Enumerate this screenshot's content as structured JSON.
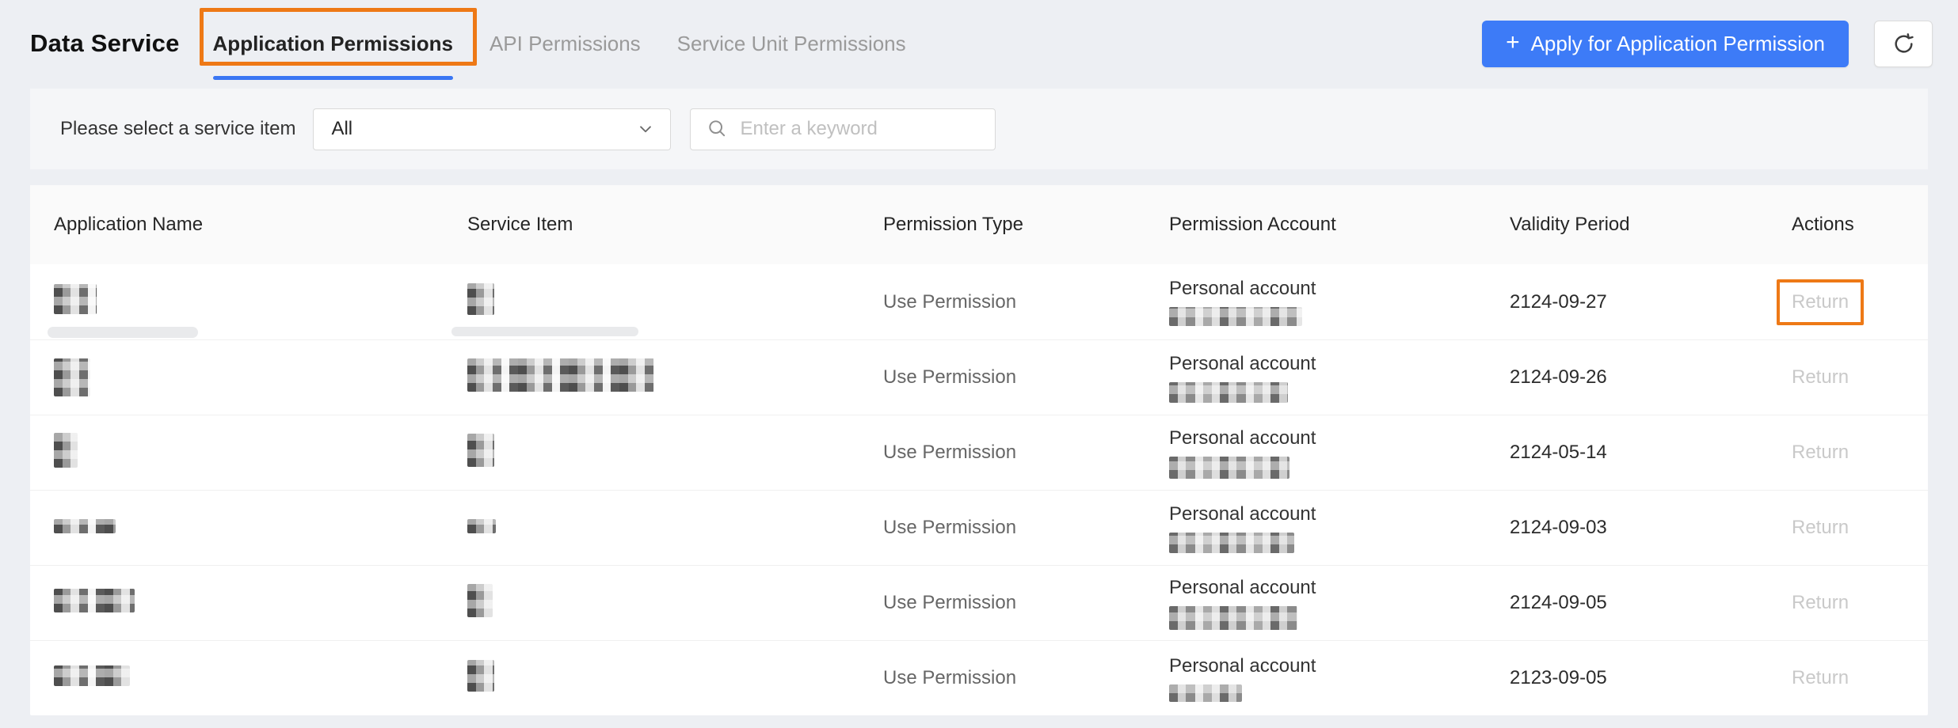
{
  "page": {
    "title": "Data Service"
  },
  "tabs": [
    {
      "label": "Application Permissions",
      "active": true
    },
    {
      "label": "API Permissions",
      "active": false
    },
    {
      "label": "Service Unit Permissions",
      "active": false
    }
  ],
  "header": {
    "plus": "+",
    "apply_label": "Apply for Application Permission"
  },
  "filter": {
    "label": "Please select a service item",
    "select_value": "All",
    "search_placeholder": "Enter a keyword"
  },
  "table": {
    "columns": [
      "Application Name",
      "Service Item",
      "Permission Type",
      "Permission Account",
      "Validity Period",
      "Actions"
    ],
    "rows": [
      {
        "permission_type": "Use Permission",
        "account_type": "Personal account",
        "validity_period": "2124-09-27",
        "action_label": "Return"
      },
      {
        "permission_type": "Use Permission",
        "account_type": "Personal account",
        "validity_period": "2124-09-26",
        "action_label": "Return"
      },
      {
        "permission_type": "Use Permission",
        "account_type": "Personal account",
        "validity_period": "2124-05-14",
        "action_label": "Return"
      },
      {
        "permission_type": "Use Permission",
        "account_type": "Personal account",
        "validity_period": "2124-09-03",
        "action_label": "Return"
      },
      {
        "permission_type": "Use Permission",
        "account_type": "Personal account",
        "validity_period": "2124-09-05",
        "action_label": "Return"
      },
      {
        "permission_type": "Use Permission",
        "account_type": "Personal account",
        "validity_period": "2123-09-05",
        "action_label": "Return"
      }
    ]
  },
  "colors": {
    "accent_blue": "#3d7bf7",
    "annotation_orange": "#ee7916",
    "tab_underline_blue": "#3a76f3",
    "return_link_gray": "#c9c9c9"
  },
  "icons": {
    "plus": "plus-icon",
    "refresh": "refresh-icon",
    "search": "search-icon",
    "chevron_down": "chevron-down-icon"
  }
}
